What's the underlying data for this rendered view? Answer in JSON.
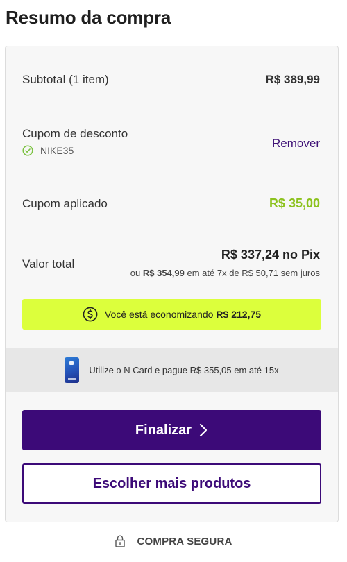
{
  "title": "Resumo da compra",
  "subtotal": {
    "label": "Subtotal (1 item)",
    "value": "R$ 389,99"
  },
  "coupon": {
    "label": "Cupom de desconto",
    "code": "NIKE35",
    "remove_label": "Remover"
  },
  "coupon_applied": {
    "label": "Cupom aplicado",
    "value": "R$ 35,00"
  },
  "total": {
    "label": "Valor total",
    "pix": "R$ 337,24 no Pix",
    "installments_prefix": "ou",
    "installments_price": "R$ 354,99",
    "installments_suffix": "em até 7x de R$ 50,71 sem juros"
  },
  "savings": {
    "text": "Você está economizando",
    "amount": "R$ 212,75"
  },
  "ncard": {
    "text": "Utilize o N Card e pague R$ 355,05 em até 15x"
  },
  "buttons": {
    "finalize": "Finalizar",
    "more_products": "Escolher mais produtos"
  },
  "secure": {
    "text": "COMPRA SEGURA"
  },
  "colors": {
    "primary": "#3c0a78",
    "discount_green": "#8cc21e",
    "savings_banner": "#dcff3c",
    "check_green": "#7cc242"
  },
  "icons": [
    "check-circle-icon",
    "dollar-circle-icon",
    "n-card-icon",
    "chevron-right-icon",
    "lock-icon"
  ]
}
